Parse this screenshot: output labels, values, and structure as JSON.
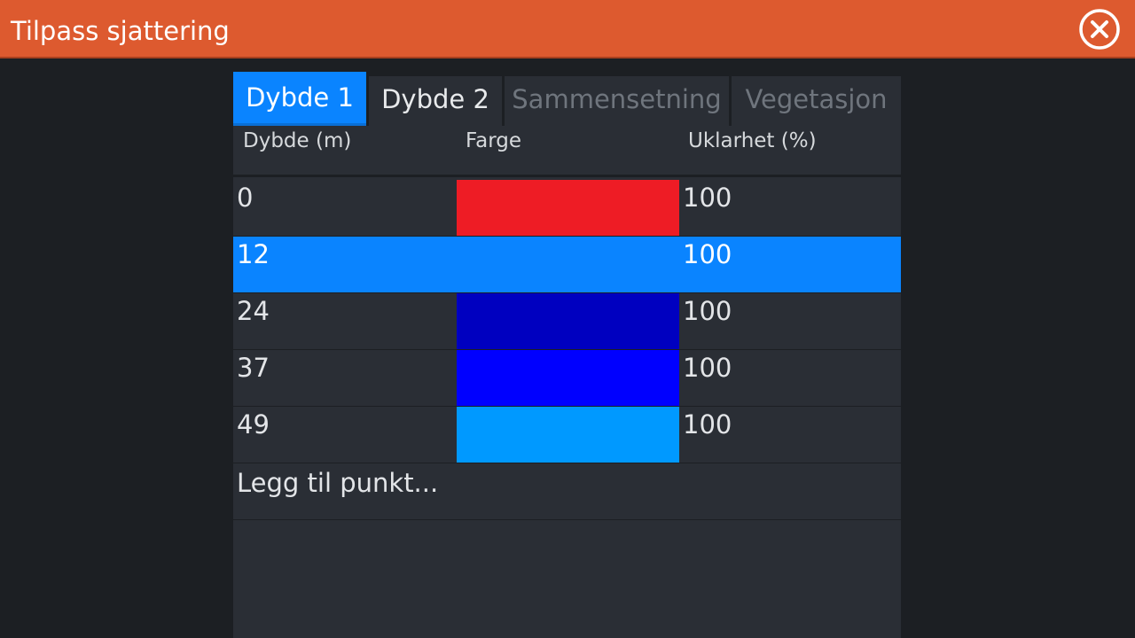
{
  "dialog": {
    "title": "Tilpass sjattering",
    "close_icon": "close-circle-icon"
  },
  "tabs": [
    {
      "label": "Dybde 1",
      "state": "active"
    },
    {
      "label": "Dybde 2",
      "state": "normal"
    },
    {
      "label": "Sammensetning",
      "state": "disabled"
    },
    {
      "label": "Vegetasjon",
      "state": "disabled"
    }
  ],
  "table": {
    "headers": [
      "Dybde (m)",
      "Farge",
      "Uklarhet (%)"
    ],
    "rows": [
      {
        "depth": "0",
        "color": "#ee1c25",
        "opacity": "100",
        "selected": false
      },
      {
        "depth": "12",
        "color": "#0a84ff",
        "opacity": "100",
        "selected": true
      },
      {
        "depth": "24",
        "color": "#0000c0",
        "opacity": "100",
        "selected": false
      },
      {
        "depth": "37",
        "color": "#0000ff",
        "opacity": "100",
        "selected": false
      },
      {
        "depth": "49",
        "color": "#0099ff",
        "opacity": "100",
        "selected": false
      }
    ],
    "add_label": "Legg til punkt..."
  }
}
